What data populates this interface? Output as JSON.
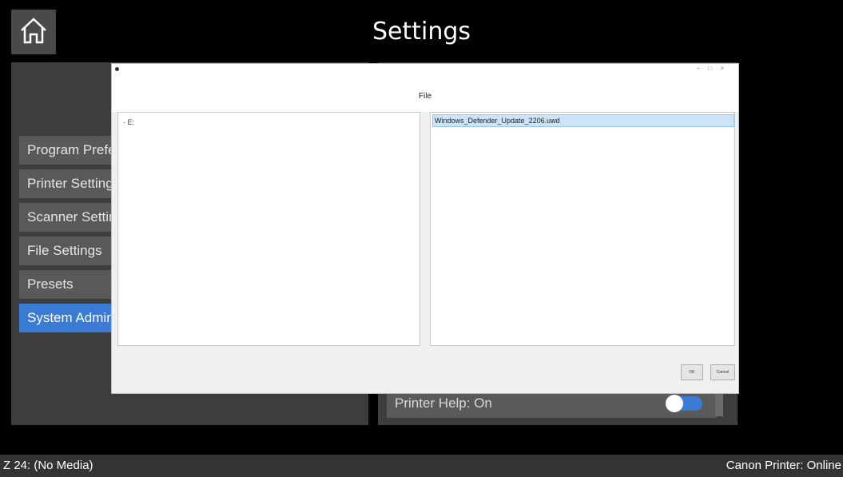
{
  "app": {
    "title": "Settings"
  },
  "icons": {
    "home": "home-icon"
  },
  "menu": {
    "items": [
      {
        "label": "Program Preferences",
        "active": false
      },
      {
        "label": "Printer Settings",
        "active": false
      },
      {
        "label": "Scanner Settings",
        "active": false
      },
      {
        "label": "File Settings",
        "active": false
      },
      {
        "label": "Presets",
        "active": false
      },
      {
        "label": "System Administration",
        "active": true
      }
    ]
  },
  "right_panel": {
    "printer_help_label": "Printer Help: On",
    "printer_help_on": true
  },
  "status_bar": {
    "left": "Z 24: (No Media)",
    "right": "Canon Printer: Online"
  },
  "dialog": {
    "title": "File",
    "tree": [
      {
        "label": "E:"
      }
    ],
    "files": [
      {
        "name": "Windows_Defender_Update_2206.uwd",
        "selected": true
      }
    ],
    "ok_label": "OK",
    "cancel_label": "Cancel"
  },
  "colors": {
    "accent": "#3a7bd5",
    "background": "#000000",
    "panel": "#3d3d3d",
    "selection": "#cce4f7"
  }
}
